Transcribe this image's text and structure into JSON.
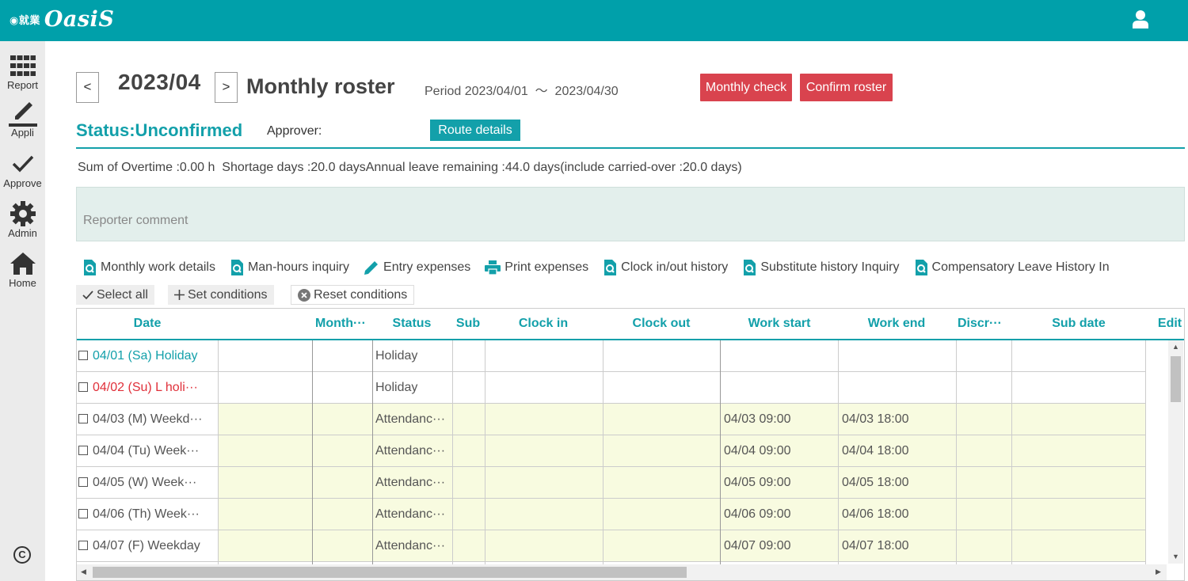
{
  "app": {
    "logo_mark": "◉就業",
    "logo_text": "OasiS"
  },
  "sidebar": {
    "items": [
      {
        "label": "Report",
        "icon": "grid-icon"
      },
      {
        "label": "Appli",
        "icon": "pencil-icon"
      },
      {
        "label": "Approve",
        "icon": "check-icon"
      },
      {
        "label": "Admin",
        "icon": "gear-icon"
      },
      {
        "label": "Home",
        "icon": "home-icon"
      }
    ],
    "copyright": "C"
  },
  "header": {
    "prev": "<",
    "next": ">",
    "month": "2023/04",
    "title": "Monthly roster",
    "period": "Period 2023/04/01  ～  2023/04/30",
    "monthly_check": "Monthly check",
    "confirm_roster": "Confirm roster",
    "status": "Status:Unconfirmed",
    "approver": "Approver:",
    "route_details": "Route details"
  },
  "summary": "Sum of Overtime :0.00 h  Shortage days :20.0 daysAnnual leave remaining :44.0 days(include carried-over :20.0 days)",
  "comment_placeholder": "Reporter comment",
  "links": [
    {
      "label": "Monthly work details",
      "icon": "search-doc-icon"
    },
    {
      "label": "Man-hours inquiry",
      "icon": "search-doc-icon"
    },
    {
      "label": "Entry expenses",
      "icon": "pencil-icon"
    },
    {
      "label": "Print expenses",
      "icon": "printer-icon"
    },
    {
      "label": "Clock in/out history",
      "icon": "search-doc-icon"
    },
    {
      "label": "Substitute history Inquiry",
      "icon": "search-doc-icon"
    },
    {
      "label": "Compensatory Leave History In",
      "icon": "search-doc-icon"
    }
  ],
  "conditions": {
    "select_all": "Select all",
    "set_conditions": "Set conditions",
    "reset_conditions": "Reset conditions"
  },
  "table": {
    "columns": [
      "Date",
      "Month···",
      "Status",
      "Sub",
      "Clock in",
      "Clock out",
      "Work start",
      "Work end",
      "Discr···",
      "Sub date",
      "Edit"
    ],
    "rows": [
      {
        "date": "04/01 (Sa) Holiday",
        "month": "",
        "status": "Holiday",
        "sub": "",
        "clock_in": "",
        "clock_out": "",
        "work_start": "",
        "work_end": "",
        "discr": "",
        "sub_date": ""
      },
      {
        "date": "04/02 (Su) L holi···",
        "month": "",
        "status": "Holiday",
        "sub": "",
        "clock_in": "",
        "clock_out": "",
        "work_start": "",
        "work_end": "",
        "discr": "",
        "sub_date": ""
      },
      {
        "date": "04/03 (M) Weekd···",
        "month": "",
        "status": "Attendanc···",
        "sub": "",
        "clock_in": "",
        "clock_out": "",
        "work_start": "04/03 09:00",
        "work_end": "04/03 18:00",
        "discr": "",
        "sub_date": ""
      },
      {
        "date": "04/04 (Tu) Week···",
        "month": "",
        "status": "Attendanc···",
        "sub": "",
        "clock_in": "",
        "clock_out": "",
        "work_start": "04/04 09:00",
        "work_end": "04/04 18:00",
        "discr": "",
        "sub_date": ""
      },
      {
        "date": "04/05 (W) Week···",
        "month": "",
        "status": "Attendanc···",
        "sub": "",
        "clock_in": "",
        "clock_out": "",
        "work_start": "04/05 09:00",
        "work_end": "04/05 18:00",
        "discr": "",
        "sub_date": ""
      },
      {
        "date": "04/06 (Th) Week···",
        "month": "",
        "status": "Attendanc···",
        "sub": "",
        "clock_in": "",
        "clock_out": "",
        "work_start": "04/06 09:00",
        "work_end": "04/06 18:00",
        "discr": "",
        "sub_date": ""
      },
      {
        "date": "04/07 (F) Weekday",
        "month": "",
        "status": "Attendanc···",
        "sub": "",
        "clock_in": "",
        "clock_out": "",
        "work_start": "04/07 09:00",
        "work_end": "04/07 18:00",
        "discr": "",
        "sub_date": ""
      }
    ]
  },
  "colors": {
    "brand": "#00a0aa",
    "danger": "#d9434e",
    "holiday_sunday": "#e0303a",
    "attendance_bg": "#f8fbe0"
  }
}
